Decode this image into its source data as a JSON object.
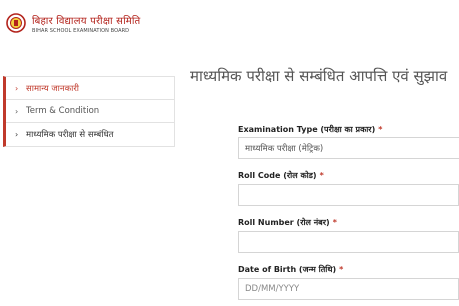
{
  "header": {
    "title_hi": "बिहार विद्यालय परीक्षा समिति",
    "title_en": "BIHAR SCHOOL EXAMINATION BOARD",
    "logo_icon": "bseb-emblem-icon"
  },
  "sidebar": {
    "items": [
      {
        "label": "सामान्य जानकारी",
        "icon": "chevron-right-icon"
      },
      {
        "label": "Term & Condition",
        "icon": "chevron-right-icon"
      },
      {
        "label": "माध्यमिक परीक्षा से सम्बंधित",
        "icon": "chevron-right-icon"
      }
    ]
  },
  "main": {
    "title": "माध्यमिक परीक्षा से सम्बंधित आपत्ति एवं सुझाव",
    "form": {
      "exam_type_label": "Examination Type (परीक्षा का प्रकार)",
      "exam_type_value": "माध्यमिक परीक्षा (मेट्रिक)",
      "roll_code_label": "Roll Code (रोल कोड)",
      "roll_code_value": "",
      "roll_number_label": "Roll Number (रोल नंबर)",
      "roll_number_value": "",
      "dob_label": "Date of Birth (जन्म तिथि)",
      "dob_placeholder": "DD/MM/YYYY",
      "required_mark": "*"
    }
  },
  "colors": {
    "brand_red": "#c0392b",
    "border": "#e2e2e2"
  }
}
